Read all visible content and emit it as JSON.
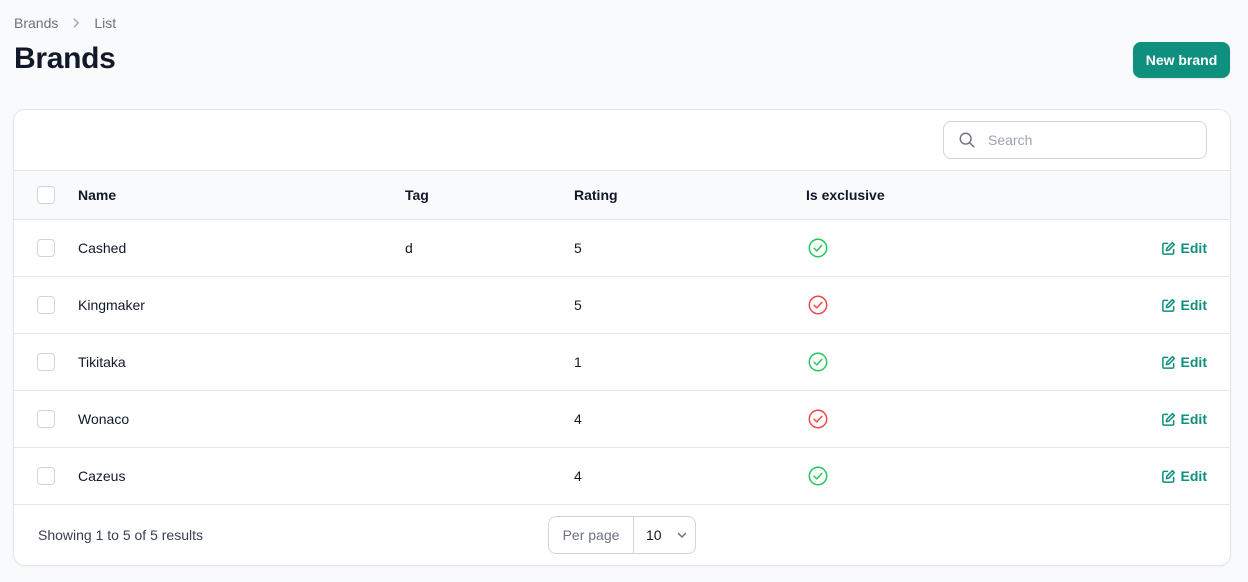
{
  "breadcrumb": {
    "items": [
      "Brands",
      "List"
    ]
  },
  "header": {
    "title": "Brands",
    "new_button": "New brand"
  },
  "search": {
    "placeholder": "Search"
  },
  "table": {
    "columns": [
      "Name",
      "Tag",
      "Rating",
      "Is exclusive"
    ],
    "rows": [
      {
        "name": "Cashed",
        "tag": "d",
        "rating": "5",
        "exclusive": true,
        "edit": "Edit"
      },
      {
        "name": "Kingmaker",
        "tag": "",
        "rating": "5",
        "exclusive": false,
        "edit": "Edit"
      },
      {
        "name": "Tikitaka",
        "tag": "",
        "rating": "1",
        "exclusive": true,
        "edit": "Edit"
      },
      {
        "name": "Wonaco",
        "tag": "",
        "rating": "4",
        "exclusive": false,
        "edit": "Edit"
      },
      {
        "name": "Cazeus",
        "tag": "",
        "rating": "4",
        "exclusive": true,
        "edit": "Edit"
      }
    ]
  },
  "footer": {
    "summary": "Showing 1 to 5 of 5 results",
    "per_page_label": "Per page",
    "per_page_value": "10"
  },
  "colors": {
    "accent": "#0f8f7d",
    "success": "#22c55e",
    "danger": "#ef4444"
  },
  "icons": {
    "breadcrumb_separator": "chevron-right-icon",
    "search": "search-icon",
    "exclusive_true": "check-circle-icon",
    "exclusive_false": "x-circle-icon",
    "edit": "edit-icon",
    "per_page_dropdown": "chevron-down-icon"
  }
}
